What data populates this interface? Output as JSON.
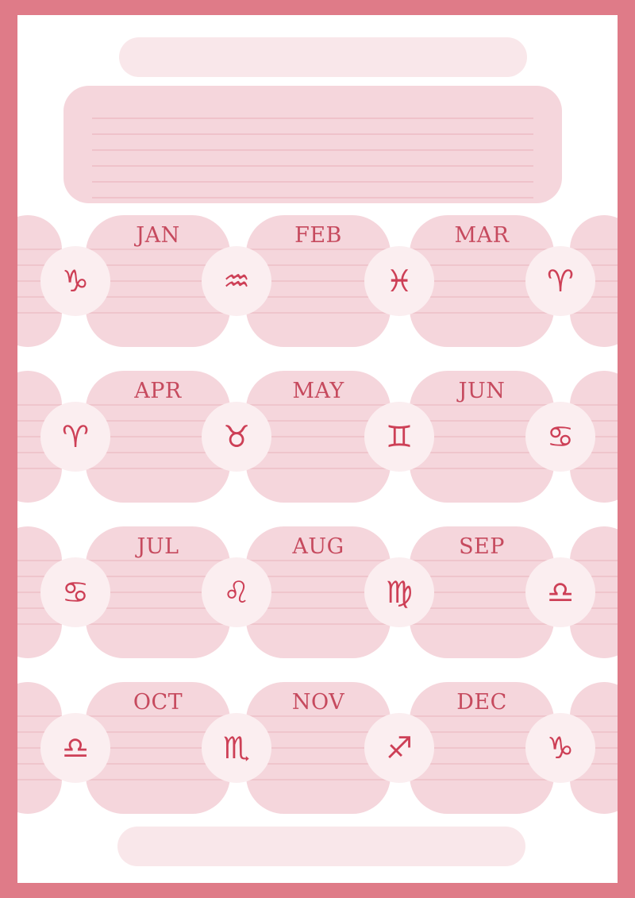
{
  "months": [
    "JAN",
    "FEB",
    "MAR",
    "APR",
    "MAY",
    "JUN",
    "JUL",
    "AUG",
    "SEP",
    "OCT",
    "NOV",
    "DEC"
  ],
  "signs": [
    {
      "name": "capricorn-icon",
      "glyph": "♑"
    },
    {
      "name": "aquarius-icon",
      "glyph": "♒"
    },
    {
      "name": "pisces-icon",
      "glyph": "♓"
    },
    {
      "name": "aries-icon",
      "glyph": "♈"
    },
    {
      "name": "aries-icon",
      "glyph": "♈"
    },
    {
      "name": "taurus-icon",
      "glyph": "♉"
    },
    {
      "name": "gemini-icon",
      "glyph": "♊"
    },
    {
      "name": "cancer-icon",
      "glyph": "♋"
    },
    {
      "name": "cancer-icon",
      "glyph": "♋"
    },
    {
      "name": "leo-icon",
      "glyph": "♌"
    },
    {
      "name": "virgo-icon",
      "glyph": "♍"
    },
    {
      "name": "libra-icon",
      "glyph": "♎"
    },
    {
      "name": "libra-icon",
      "glyph": "♎"
    },
    {
      "name": "scorpio-icon",
      "glyph": "♏"
    },
    {
      "name": "sagittarius-icon",
      "glyph": "♐"
    },
    {
      "name": "capricorn-icon",
      "glyph": "♑"
    }
  ],
  "colors": {
    "frame": "#df7b88",
    "panel": "#f5d6dc",
    "accent": "#c64a5e"
  }
}
